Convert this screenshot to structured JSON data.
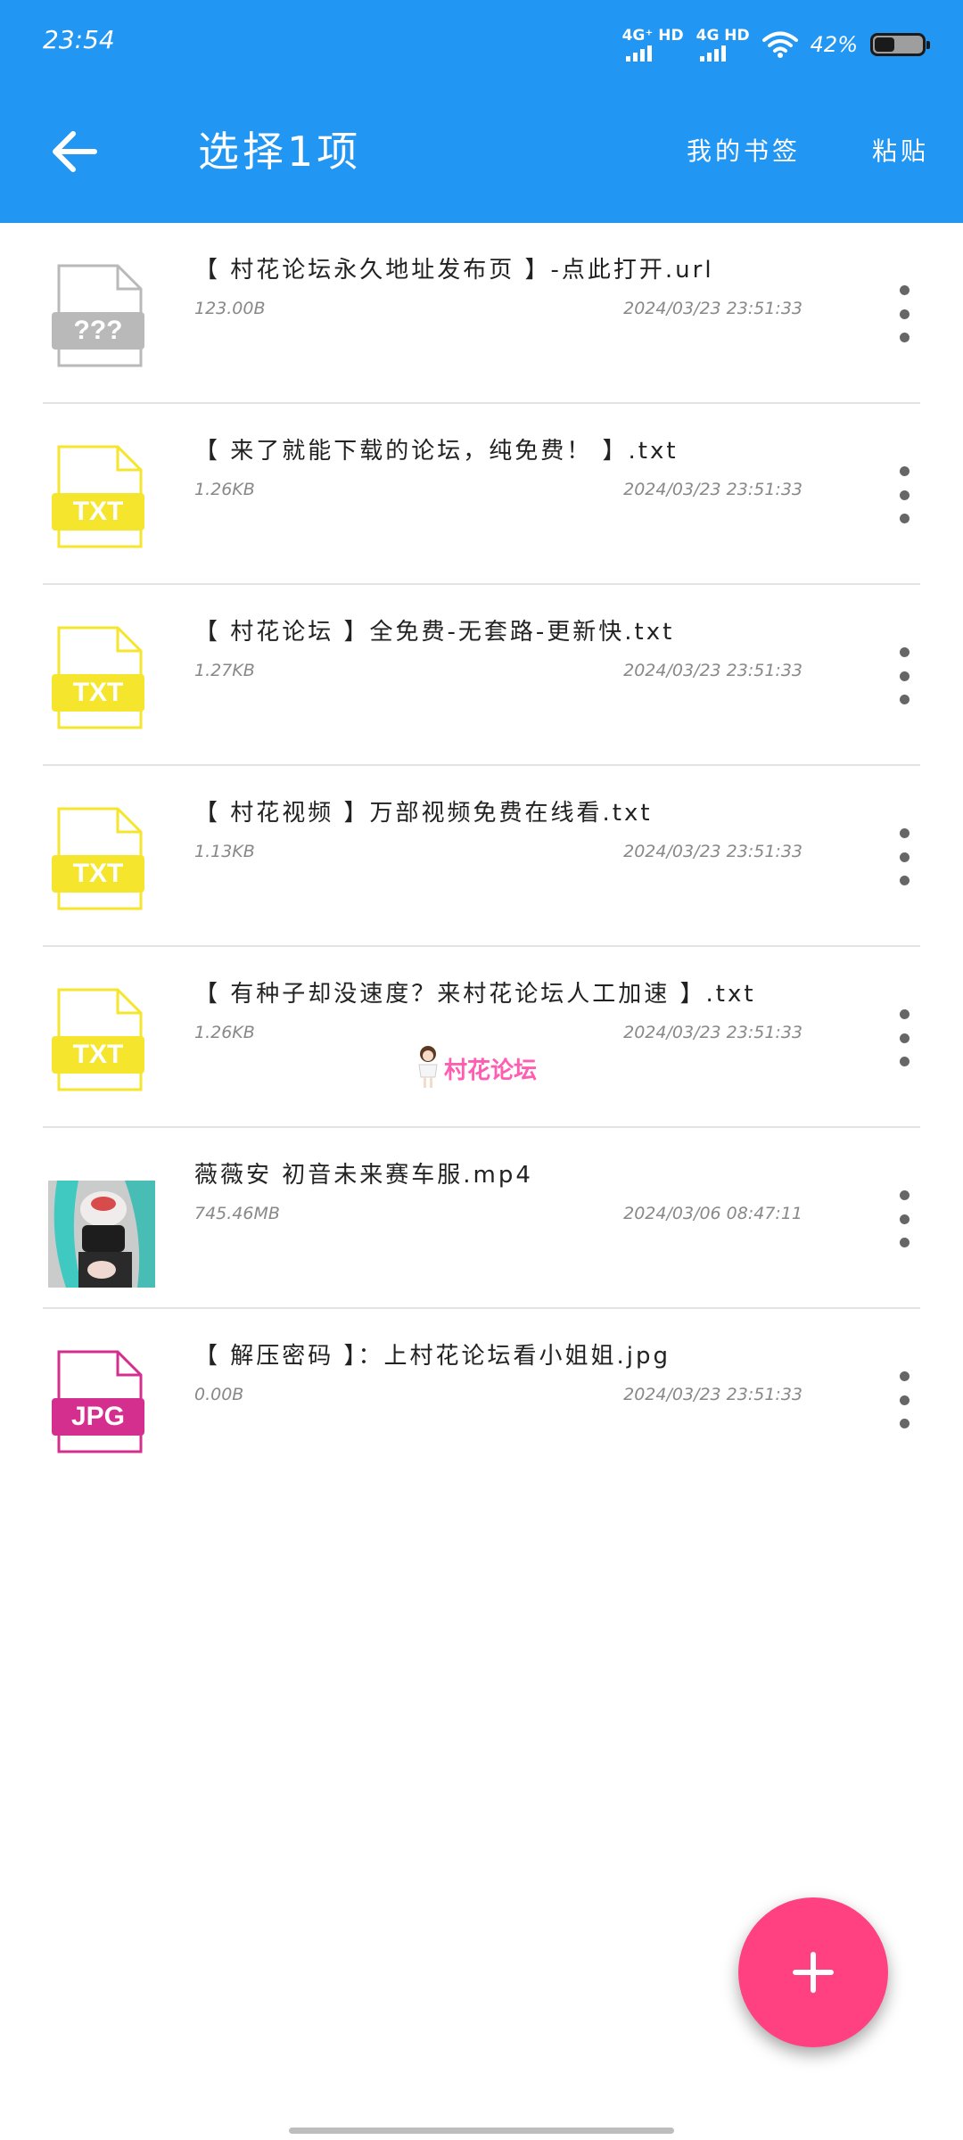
{
  "status_bar": {
    "time": "23:54",
    "network1": "4G⁺ HD",
    "network2": "4G HD",
    "battery_percent": "42%",
    "battery_level": 0.42
  },
  "toolbar": {
    "title": "选择1项",
    "bookmarks_label": "我的书签",
    "paste_label": "粘贴",
    "back_icon": "arrow-left-icon"
  },
  "colors": {
    "primary": "#2196f3",
    "accent": "#ff4081",
    "txt_icon": "#f5e52d",
    "jpg_icon": "#d42f8e",
    "unknown_icon": "#b9b9b9"
  },
  "files": [
    {
      "name": "【 村花论坛永久地址发布页 】-点此打开.url",
      "size": "123.00B",
      "date": "2024/03/23 23:51:33",
      "type": "unknown",
      "badge": "???"
    },
    {
      "name": "【 来了就能下载的论坛，纯免费！ 】.txt",
      "size": "1.26KB",
      "date": "2024/03/23 23:51:33",
      "type": "txt",
      "badge": "TXT"
    },
    {
      "name": "【 村花论坛 】全免费-无套路-更新快.txt",
      "size": "1.27KB",
      "date": "2024/03/23 23:51:33",
      "type": "txt",
      "badge": "TXT"
    },
    {
      "name": "【 村花视频 】万部视频免费在线看.txt",
      "size": "1.13KB",
      "date": "2024/03/23 23:51:33",
      "type": "txt",
      "badge": "TXT"
    },
    {
      "name": "【 有种子却没速度？来村花论坛人工加速 】.txt",
      "size": "1.26KB",
      "date": "2024/03/23 23:51:33",
      "type": "txt",
      "badge": "TXT"
    },
    {
      "name": "薇薇安 初音未来赛车服.mp4",
      "size": "745.46MB",
      "date": "2024/03/06 08:47:11",
      "type": "video",
      "badge": ""
    },
    {
      "name": "【 解压密码 】：上村花论坛看小姐姐.jpg",
      "size": "0.00B",
      "date": "2024/03/23 23:51:33",
      "type": "jpg",
      "badge": "JPG"
    }
  ],
  "watermark": {
    "text": "村花论坛"
  },
  "fab": {
    "icon": "plus-icon"
  }
}
